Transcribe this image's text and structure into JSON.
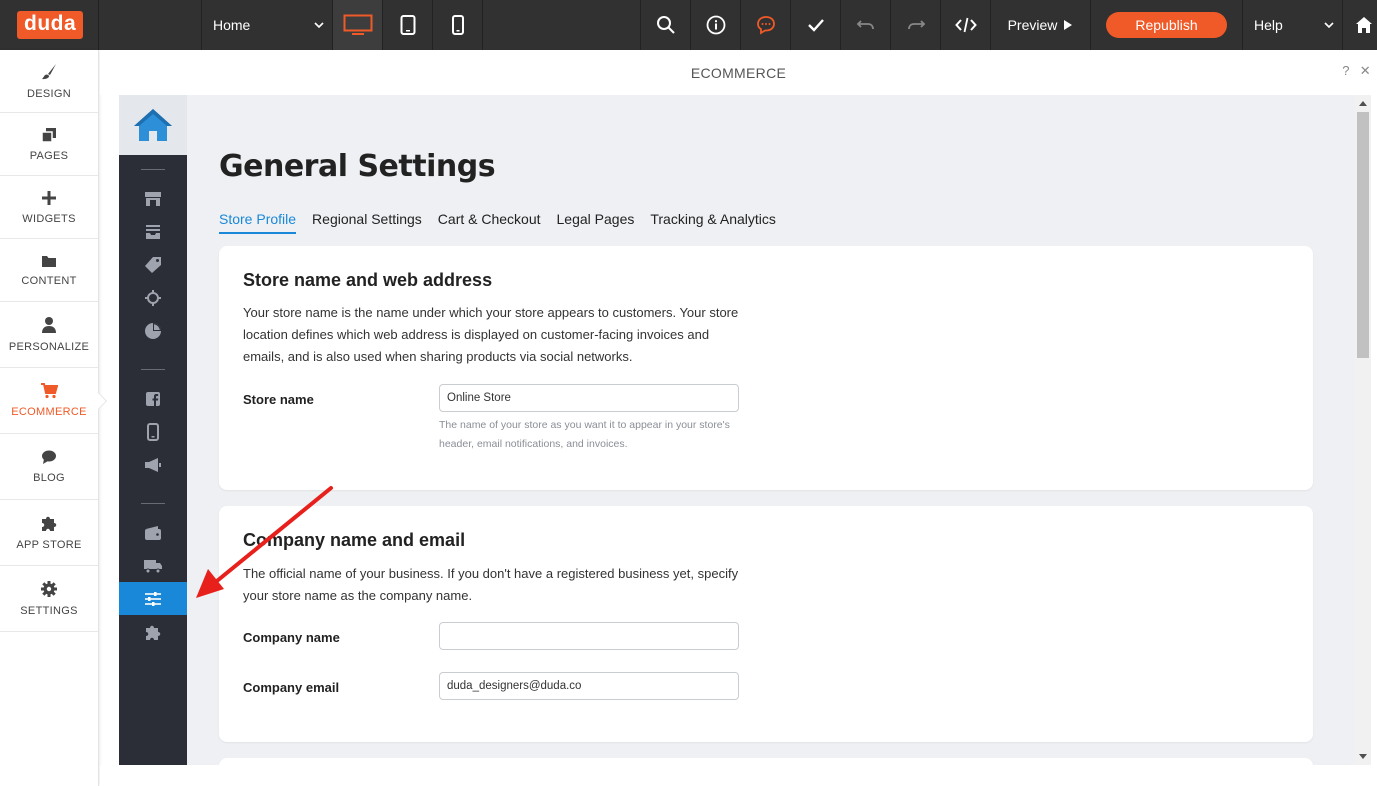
{
  "topbar": {
    "logo": "duda",
    "page_select": "Home",
    "preview_label": "Preview",
    "republish_label": "Republish",
    "help_label": "Help",
    "icons": [
      "desktop-icon",
      "tablet-icon",
      "mobile-icon",
      "search-icon",
      "info-icon",
      "comments-icon",
      "checkmark-icon",
      "undo-icon",
      "redo-icon",
      "code-icon",
      "home-icon"
    ],
    "colors": {
      "bar": "#313131",
      "accent": "#f05a28"
    }
  },
  "sidebar": {
    "items": [
      {
        "label": "DESIGN",
        "icon": "brush-icon"
      },
      {
        "label": "PAGES",
        "icon": "pages-icon"
      },
      {
        "label": "WIDGETS",
        "icon": "plus-icon"
      },
      {
        "label": "CONTENT",
        "icon": "folder-icon"
      },
      {
        "label": "PERSONALIZE",
        "icon": "person-icon"
      },
      {
        "label": "ECOMMERCE",
        "icon": "cart-icon",
        "active": true
      },
      {
        "label": "BLOG",
        "icon": "chat-bubble-icon"
      },
      {
        "label": "APP STORE",
        "icon": "puzzle-icon"
      },
      {
        "label": "SETTINGS",
        "icon": "gear-icon"
      }
    ]
  },
  "panel": {
    "title": "ECOMMERCE",
    "help_symbol": "?",
    "close_symbol": "✕"
  },
  "eco_nav": {
    "icons": [
      "store-icon",
      "inbox-icon",
      "tag-icon",
      "crosshair-icon",
      "pie-chart-icon",
      "facebook-icon",
      "mobile-icon",
      "megaphone-icon",
      "wallet-icon",
      "truck-icon",
      "sliders-icon",
      "puzzle-icon"
    ],
    "active": "sliders-icon",
    "accent": "#1a88d8"
  },
  "main": {
    "title": "General Settings",
    "tabs": [
      "Store Profile",
      "Regional Settings",
      "Cart & Checkout",
      "Legal Pages",
      "Tracking & Analytics"
    ],
    "active_tab": "Store Profile",
    "store_card": {
      "heading": "Store name and web address",
      "description": "Your store name is the name under which your store appears to customers. Your store location defines which web address is displayed on customer-facing invoices and emails, and is also used when sharing products via social networks.",
      "store_name_label": "Store name",
      "store_name_value": "Online Store",
      "store_name_hint": "The name of your store as you want it to appear in your store's header, email notifications, and invoices."
    },
    "company_card": {
      "heading": "Company name and email",
      "description": "The official name of your business. If you don't have a registered business yet, specify your store name as the company name.",
      "company_name_label": "Company name",
      "company_name_value": "",
      "company_email_label": "Company email",
      "company_email_value": "duda_designers@duda.co"
    }
  }
}
